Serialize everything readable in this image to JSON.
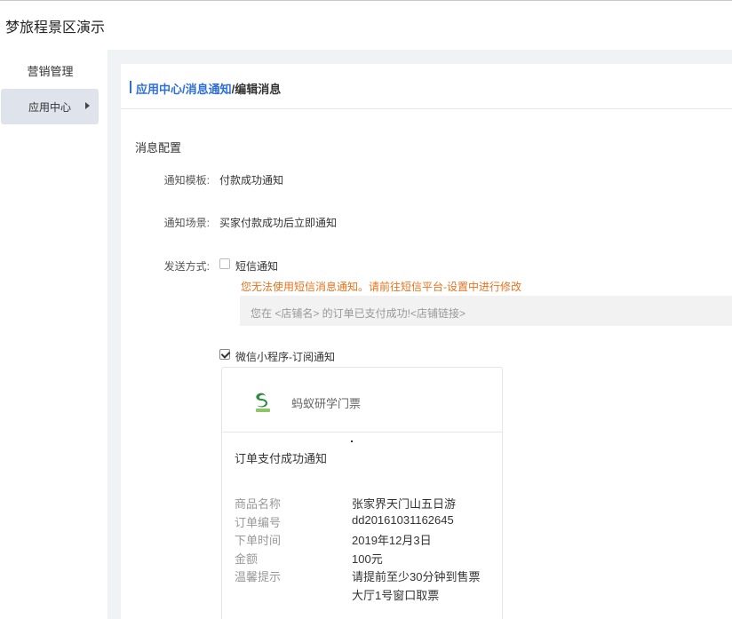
{
  "app": {
    "title": "梦旅程景区演示"
  },
  "sidebar": {
    "group_label": "营销管理",
    "items": [
      {
        "label": "应用中心"
      }
    ]
  },
  "breadcrumb": {
    "items": [
      "应用中心",
      "/",
      "消息通知",
      "/编辑消息"
    ]
  },
  "form": {
    "section_title": "消息配置",
    "template_label": "通知模板:",
    "template_value": "付款成功通知",
    "scene_label": "通知场景:",
    "scene_value": "买家付款成功后立即通知",
    "send_label": "发送方式:",
    "sms": {
      "label": "短信通知",
      "checked": false,
      "warning": "您无法使用短信消息通知。请前往短信平台-设置中进行修改",
      "preview": "您在 <店铺名> 的订单已支付成功!<店铺链接>"
    },
    "wechat": {
      "label": "微信小程序-订阅通知",
      "checked": true
    }
  },
  "wechat_card": {
    "app_name": "蚂蚁研学门票",
    "logo_icon": "green-leaf-logo-icon",
    "notice_title": "订单支付成功通知",
    "fields": [
      {
        "key": "商品名称",
        "value": "张家界天门山五日游"
      },
      {
        "key": "订单编号",
        "value": "dd20161031162645"
      },
      {
        "key": "下单时间",
        "value": "2019年12月3日"
      },
      {
        "key": "金额",
        "value": "100元"
      },
      {
        "key": "温馨提示",
        "value": "请提前至少30分钟到售票"
      },
      {
        "key": "",
        "value": "大厅1号窗口取票"
      }
    ]
  },
  "colors": {
    "accent": "#2f6fd6",
    "warning": "#e6731e",
    "sidebar_active": "#dfe3ec"
  }
}
